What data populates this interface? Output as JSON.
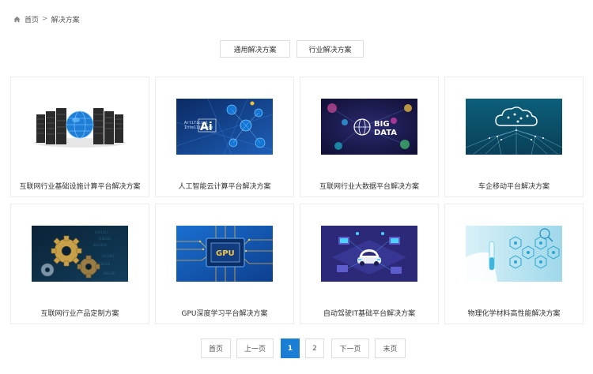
{
  "breadcrumb": {
    "home": "首页",
    "separator": ">",
    "current": "解决方案"
  },
  "tabs": [
    {
      "label": "通用解决方案"
    },
    {
      "label": "行业解决方案"
    }
  ],
  "cards": [
    {
      "title": "互联网行业基础设施计算平台解决方案",
      "image": "server-rack-globe"
    },
    {
      "title": "人工智能云计算平台解决方案",
      "image": "artificial-intelligence",
      "image_text": [
        "Artificial",
        "Intelligence",
        "Ai"
      ]
    },
    {
      "title": "互联网行业大数据平台解决方案",
      "image": "big-data",
      "image_text": [
        "BIG",
        "DATA"
      ]
    },
    {
      "title": "车企移动平台解决方案",
      "image": "cloud-network"
    },
    {
      "title": "互联网行业产品定制方案",
      "image": "gears"
    },
    {
      "title": "GPU深度学习平台解决方案",
      "image": "gpu-chip",
      "image_text": [
        "GPU"
      ]
    },
    {
      "title": "自动驾驶IT基础平台解决方案",
      "image": "autonomous-car"
    },
    {
      "title": "物理化学材料高性能解决方案",
      "image": "lab-hexagons"
    }
  ],
  "pagination": {
    "first": "首页",
    "prev": "上一页",
    "pages": [
      "1",
      "2"
    ],
    "current": "1",
    "next": "下一页",
    "last": "末页"
  },
  "colors": {
    "accent": "#1a7fd4",
    "border": "#ececec"
  }
}
